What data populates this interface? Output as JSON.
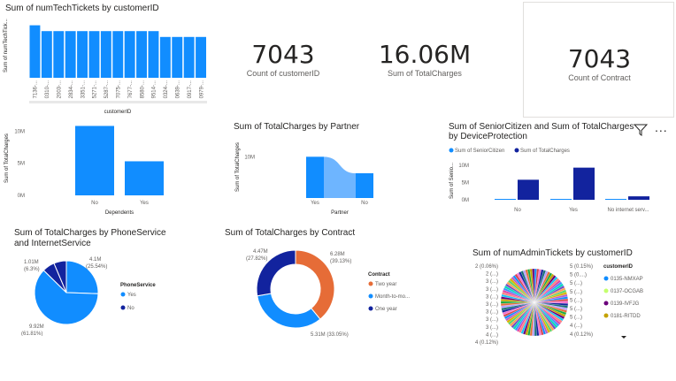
{
  "colors": {
    "blue": "#118dff",
    "darkblue": "#12239e",
    "orange": "#e66c37",
    "purple": "#6b007b",
    "lightblue": "#6eb5ff"
  },
  "cards": [
    {
      "value": "7043",
      "label": "Count of customerID"
    },
    {
      "value": "16.06M",
      "label": "Sum of TotalCharges"
    },
    {
      "value": "7043",
      "label": "Count of Contract"
    }
  ],
  "toolbar": {
    "filter_icon": "filter-icon",
    "more_icon": "more-options-icon",
    "more_label": "..."
  },
  "chart_data": [
    {
      "type": "bar",
      "title": "Sum of numTechTickets by customerID",
      "xlabel": "customerID",
      "ylabel": "Sum of numTechTick...",
      "categories": [
        "7136-...",
        "0310-...",
        "2003-...",
        "2834-...",
        "3351-...",
        "5271-...",
        "5287-...",
        "7075-...",
        "7677-...",
        "8580-...",
        "9514-...",
        "0324-...",
        "0639-...",
        "0917-...",
        "0979-..."
      ],
      "values": [
        9,
        8,
        8,
        8,
        8,
        8,
        8,
        8,
        8,
        8,
        8,
        7,
        7,
        7,
        7
      ],
      "ylim": [
        0,
        10
      ]
    },
    {
      "type": "bar",
      "title": "",
      "xlabel": "Dependents",
      "ylabel": "Sum of TotalCharges",
      "categories": [
        "No",
        "Yes"
      ],
      "values": [
        10.8,
        5.3
      ],
      "yticks": [
        "0M",
        "5M",
        "10M"
      ],
      "ylim": [
        0,
        11
      ]
    },
    {
      "type": "area",
      "title": "Sum of TotalCharges by Partner",
      "xlabel": "Partner",
      "ylabel": "Sum of TotalCharges",
      "categories": [
        "Yes",
        "No"
      ],
      "values": [
        10.0,
        6.0
      ],
      "yticks": [
        "10M"
      ],
      "ylim": [
        0,
        12
      ]
    },
    {
      "type": "bar",
      "title": "Sum of SeniorCitizen and Sum of TotalCharges by DeviceProtection",
      "xlabel": "",
      "ylabel": "Sum of Senio...",
      "categories": [
        "No",
        "Yes",
        "No internet serv..."
      ],
      "series": [
        {
          "name": "Sum of SeniorCitizen",
          "values": [
            0.15,
            0.15,
            0.05
          ]
        },
        {
          "name": "Sum of TotalCharges",
          "values": [
            5.8,
            9.3,
            1.0
          ]
        }
      ],
      "yticks": [
        "0M",
        "5M",
        "10M"
      ],
      "ylim": [
        0,
        11
      ]
    },
    {
      "type": "pie",
      "title": "Sum of TotalCharges by PhoneService and InternetService",
      "legend_title": "PhoneService",
      "slices": [
        {
          "name": "Yes",
          "value": 9.92,
          "label": "9.92M",
          "pct": "(61.81%)"
        },
        {
          "name": "Yes",
          "value": 4.1,
          "label": "4.1M",
          "pct": "(25.54%)"
        },
        {
          "name": "No",
          "value": 1.01,
          "label": "1.01M",
          "pct": "(6.3%)"
        },
        {
          "name": "No",
          "value": 1.02,
          "label": "",
          "pct": ""
        }
      ],
      "legend": [
        {
          "name": "Yes"
        },
        {
          "name": "No"
        }
      ]
    },
    {
      "type": "pie",
      "title": "Sum of TotalCharges by Contract",
      "legend_title": "Contract",
      "slices": [
        {
          "name": "Two year",
          "value": 6.28,
          "label": "6.28M",
          "pct": "(39.13%)"
        },
        {
          "name": "Month-to-mo...",
          "value": 5.31,
          "label": "5.31M (33.05%)",
          "pct": ""
        },
        {
          "name": "One year",
          "value": 4.47,
          "label": "4.47M",
          "pct": "(27.82%)"
        }
      ]
    },
    {
      "type": "pie",
      "title": "Sum of numAdminTickets by customerID",
      "legend_title": "customerID",
      "legend": [
        "0135-NMXAP",
        "0137-OCGAB",
        "0139-IVFJG",
        "0181-RITDD"
      ],
      "labels_left": [
        "2 (0.06%)",
        "2 (...)",
        "3 (...)",
        "3 (...)",
        "3 (...)",
        "3 (...)",
        "3 (...)",
        "3 (...)",
        "3 (...)",
        "4 (...)",
        "4 (0.12%)"
      ],
      "labels_right": [
        "5 (0.15%)",
        "5 (0....)",
        "5 (...)",
        "5 (...)",
        "5 (...)",
        "5 (...)",
        "5 (...)",
        "4 (...)",
        "4 (0.12%)"
      ]
    }
  ]
}
